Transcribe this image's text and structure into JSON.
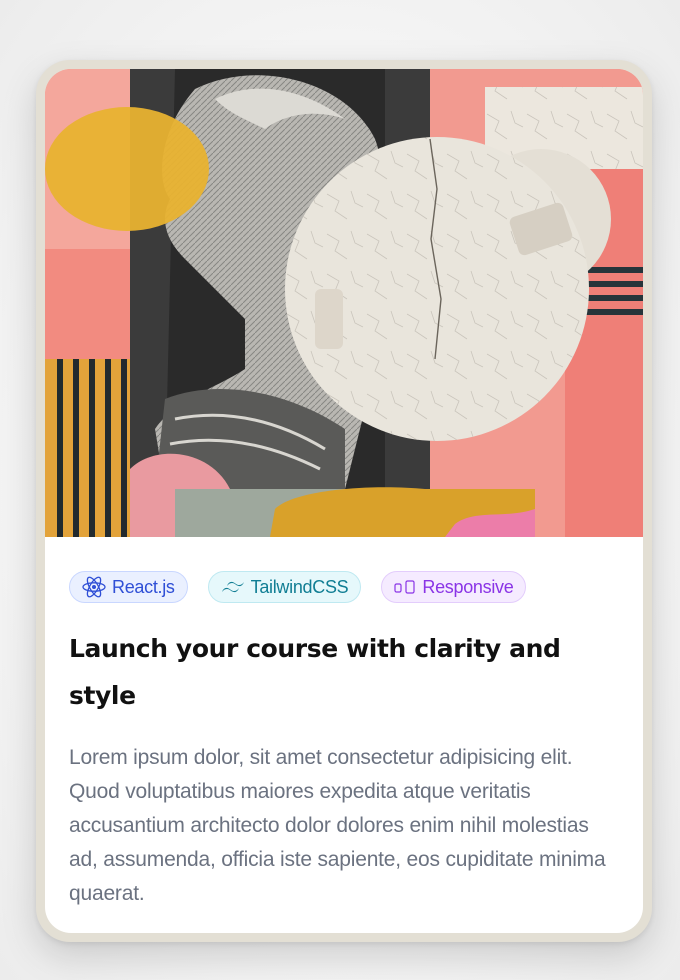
{
  "card": {
    "tags": [
      {
        "label": "React.js",
        "icon": "react-icon",
        "color": "#2f4fd6"
      },
      {
        "label": "TailwindCSS",
        "icon": "tailwind-icon",
        "color": "#117e94"
      },
      {
        "label": "Responsive",
        "icon": "devices-icon",
        "color": "#8a34e6"
      }
    ],
    "title": "Launch your course with clarity and style",
    "description": "Lorem ipsum dolor, sit amet consectetur adipisicing elit. Quod voluptatibus maiores expedita atque veritatis accusantium architecto dolor dolores enim nihil molestias ad, assumenda, officia iste sapiente, eos cupiditate minima quaerat."
  },
  "colors": {
    "card_border": "#e3dfd4",
    "title": "#111111",
    "description": "#6b7280"
  }
}
